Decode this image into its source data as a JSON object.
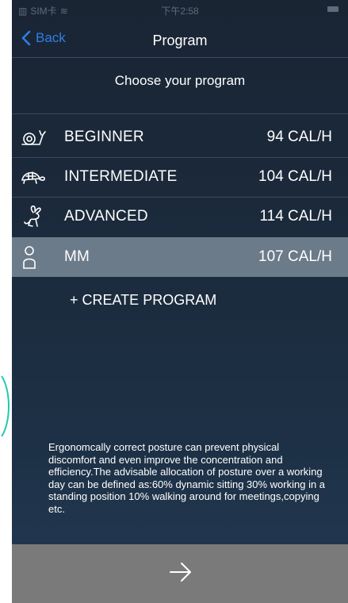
{
  "status_bar": {
    "carrier": "SIM卡",
    "time": "下午2:58"
  },
  "nav": {
    "back_label": "Back",
    "title": "Program"
  },
  "subtitle": "Choose your program",
  "programs": [
    {
      "name": "BEGINNER",
      "calories": "94 CAL/H",
      "icon": "snail-icon",
      "selected": false
    },
    {
      "name": "INTERMEDIATE",
      "calories": "104 CAL/H",
      "icon": "turtle-icon",
      "selected": false
    },
    {
      "name": "ADVANCED",
      "calories": "114 CAL/H",
      "icon": "rabbit-icon",
      "selected": false
    },
    {
      "name": "MM",
      "calories": "107 CAL/H",
      "icon": "person-icon",
      "selected": true
    }
  ],
  "create_label": "+ CREATE PROGRAM",
  "tip": "Ergonomcally correct posture can prevent physical discomfort and even improve the concentration and efficiency.The advisable allocation of posture over a working day can be defined as:60% dynamic sitting 30% working in a standing position 10% walking around for meetings,copying etc.",
  "colors": {
    "accent": "#2f7fe6",
    "selected_row": "#6c7b8a",
    "footer": "#7a7a7a",
    "background": "#1b2a3c"
  },
  "footer": {
    "icon": "arrow-right-icon"
  }
}
